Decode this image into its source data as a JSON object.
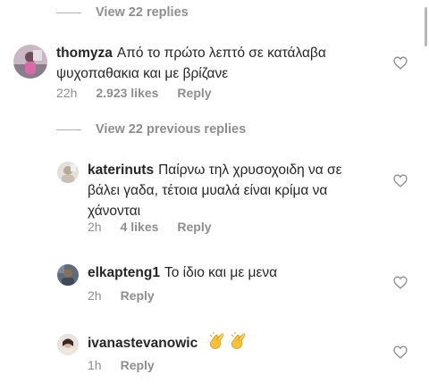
{
  "top_view_replies": "View 22 replies",
  "previous_replies": "View 22 previous replies",
  "comments": [
    {
      "username": "thomyza",
      "text_line1": "Από το πρώτο  λεπτό σε κατάλαβα",
      "text_line2": "ψυχοπαθακια και με βρίζανε",
      "time": "22h",
      "likes": "2.923 likes",
      "reply": "Reply"
    },
    {
      "username": "katerinuts",
      "text_line1": "Παίρνω τηλ χρυσοχοιδη να σε",
      "text_line2": "βάλει γαδα, τέτοια μυαλά είναι κρίμα να",
      "text_line3": "χάνονται",
      "time": "2h",
      "likes": "4 likes",
      "reply": "Reply"
    },
    {
      "username": "elkapteng1",
      "text_line1": "Το ίδιο και με μενα",
      "time": "2h",
      "reply": "Reply"
    },
    {
      "username": "ivanastevanowic",
      "emoji": "👏👏",
      "time": "1h",
      "reply": "Reply"
    }
  ],
  "colors": {
    "text": "#262626",
    "meta": "#8e8e8e",
    "heart": "#8e8e8e"
  },
  "icons": [
    "heart-outline-icon",
    "clapping-hands-icon"
  ]
}
